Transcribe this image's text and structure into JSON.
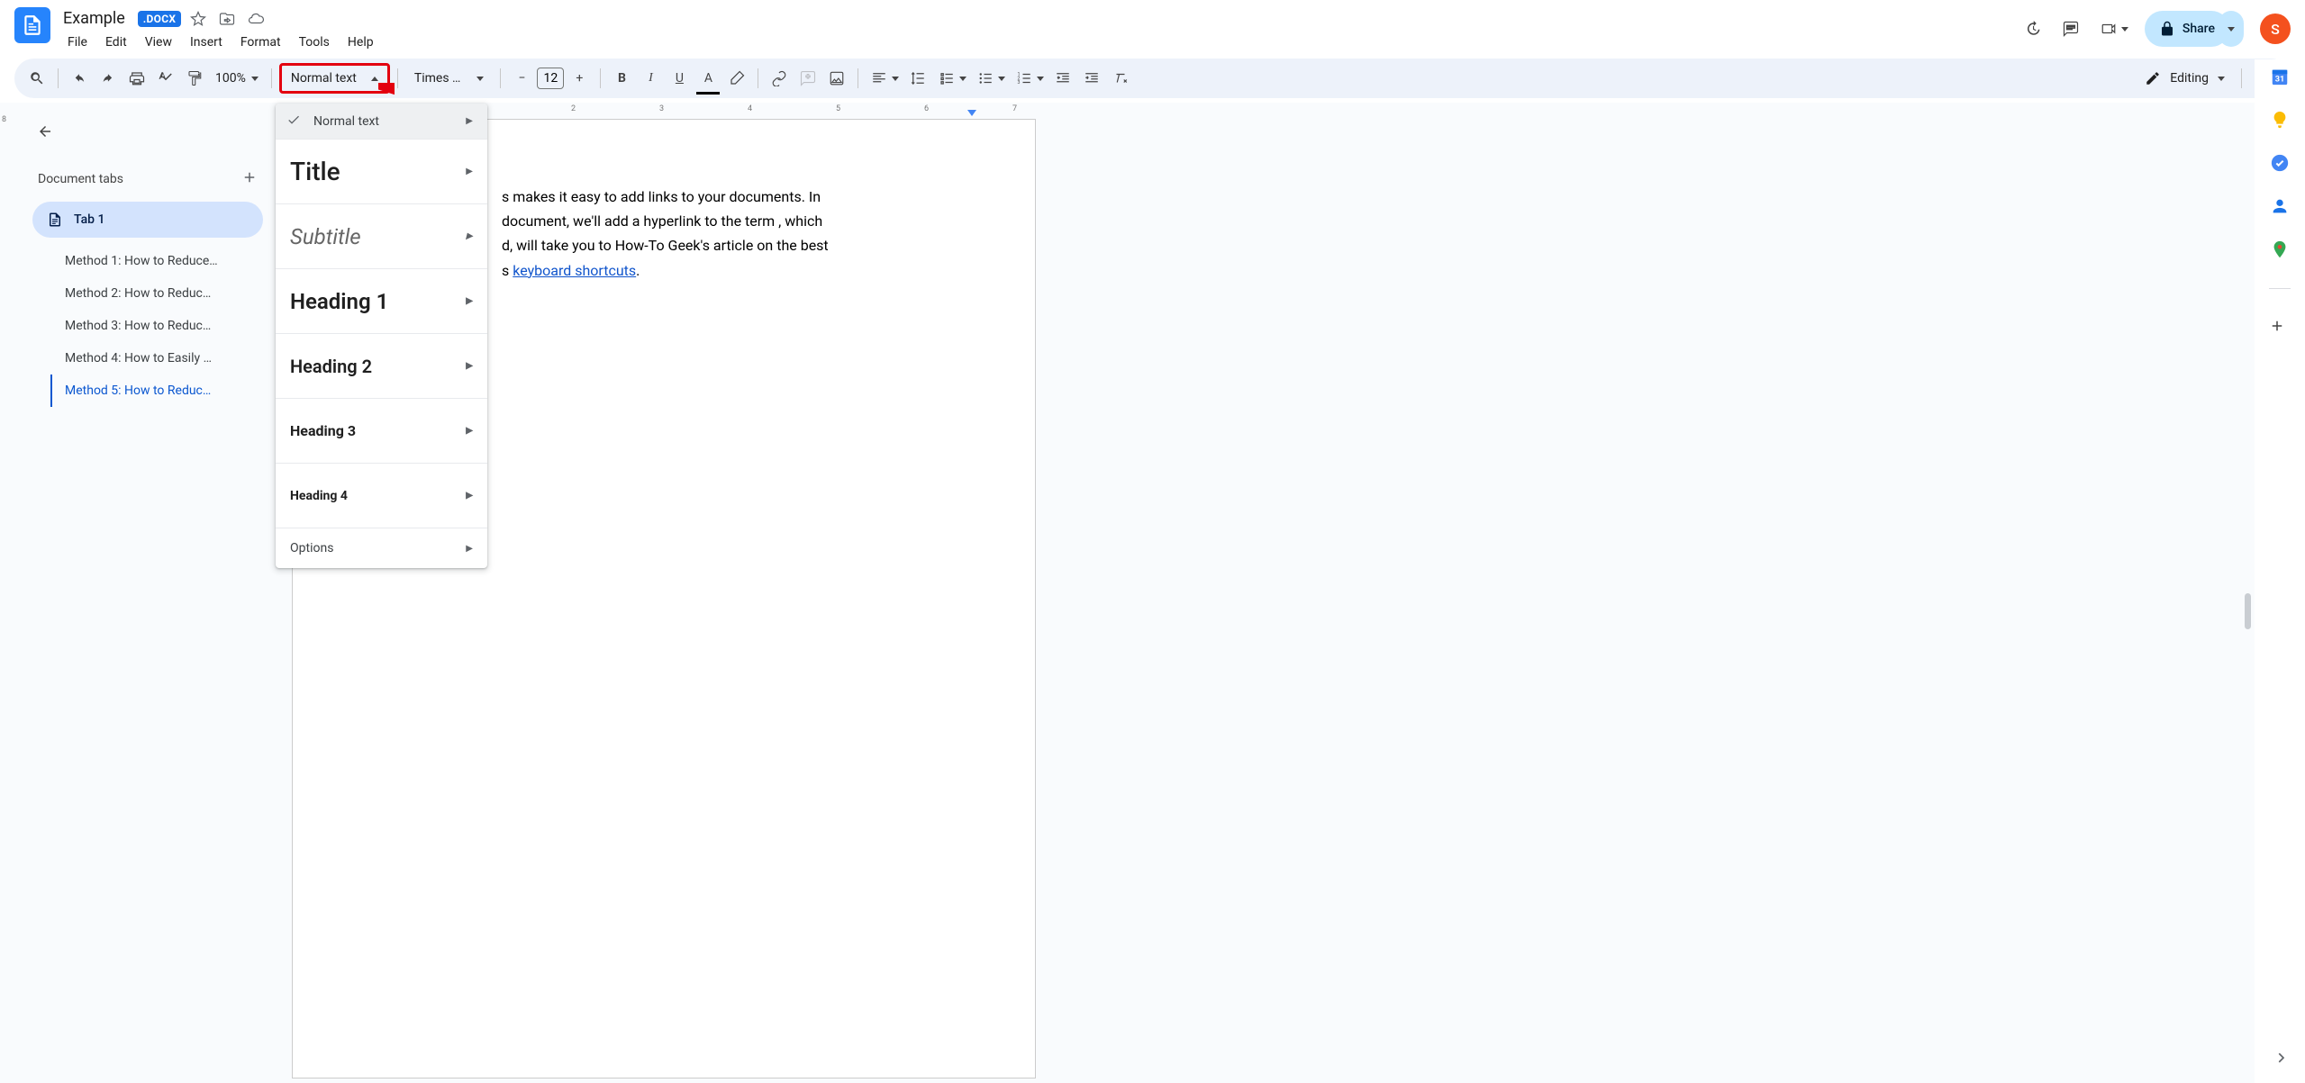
{
  "header": {
    "doc_title": "Example",
    "docx_badge": ".DOCX",
    "menus": [
      "File",
      "Edit",
      "View",
      "Insert",
      "Format",
      "Tools",
      "Help"
    ],
    "share_label": "Share",
    "avatar_letter": "S"
  },
  "toolbar": {
    "zoom": "100%",
    "style_selector": "Normal text",
    "font": "Times …",
    "font_size": "12",
    "editing_mode": "Editing"
  },
  "styles_dropdown": {
    "items": [
      {
        "label": "Normal text",
        "cls": "dd-normal",
        "selected": true
      },
      {
        "label": "Title",
        "cls": "dd-title",
        "selected": false
      },
      {
        "label": "Subtitle",
        "cls": "dd-subtitle",
        "selected": false
      },
      {
        "label": "Heading 1",
        "cls": "dd-h1",
        "selected": false
      },
      {
        "label": "Heading 2",
        "cls": "dd-h2",
        "selected": false
      },
      {
        "label": "Heading 3",
        "cls": "dd-h3",
        "selected": false
      },
      {
        "label": "Heading 4",
        "cls": "dd-h4",
        "selected": false
      },
      {
        "label": "Options",
        "cls": "dd-opt",
        "selected": false
      }
    ]
  },
  "left_panel": {
    "tabs_header": "Document tabs",
    "tab1": "Tab 1",
    "outline": [
      {
        "label": "Method 1: How to Reduce…",
        "active": false
      },
      {
        "label": "Method 2: How to Reduc…",
        "active": false
      },
      {
        "label": "Method 3: How to Reduc…",
        "active": false
      },
      {
        "label": "Method 4: How to Easily …",
        "active": false
      },
      {
        "label": "Method 5: How to Reduc…",
        "active": true
      }
    ]
  },
  "ruler": {
    "hmarks": [
      "2",
      "3",
      "4",
      "5",
      "6",
      "7"
    ],
    "vmark": "8"
  },
  "document": {
    "line1_a": "s makes it easy to add links to your documents. In",
    "line2_a": "document, we'll add a hyperlink to the term , which",
    "line3_a": "d, will take you to How-To Geek's article on the best",
    "line4_a": "s ",
    "link_text": "keyboard shortcuts",
    "line4_b": "."
  }
}
